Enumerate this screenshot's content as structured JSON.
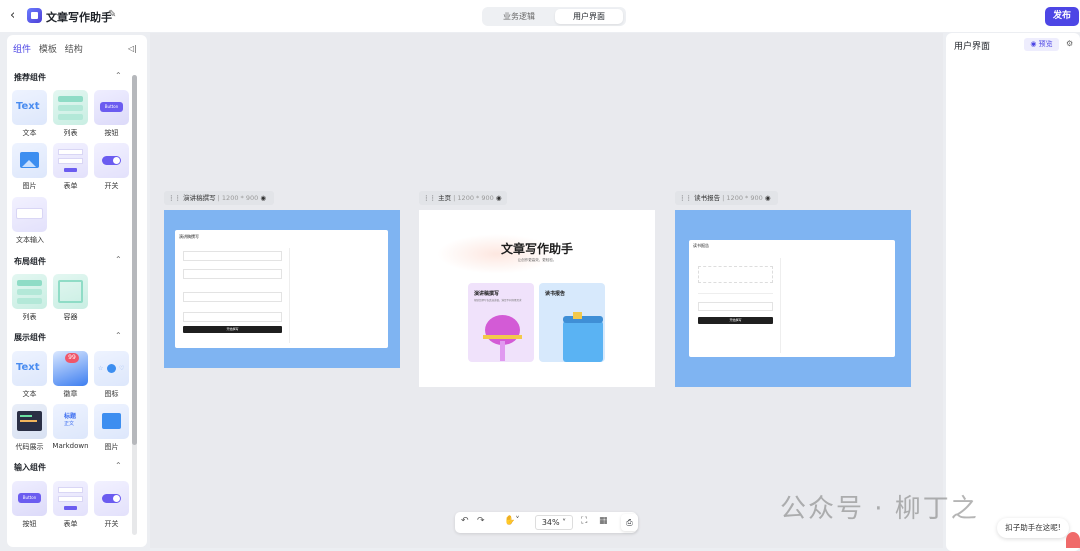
{
  "header": {
    "app_title": "文章写作助手",
    "tabs": [
      {
        "label": "业务逻辑"
      },
      {
        "label": "用户界面"
      }
    ],
    "publish_label": "发布"
  },
  "left_panel": {
    "tabs": [
      "组件",
      "模板",
      "结构"
    ],
    "sections": [
      {
        "title": "推荐组件",
        "items": [
          "文本",
          "列表",
          "按钮",
          "图片",
          "表单",
          "开关",
          "文本输入"
        ]
      },
      {
        "title": "布局组件",
        "items": [
          "列表",
          "容器"
        ]
      },
      {
        "title": "展示组件",
        "items": [
          "文本",
          "徽章",
          "图标",
          "代码展示",
          "Markdown",
          "图片"
        ]
      },
      {
        "title": "输入组件",
        "items": [
          "按钮",
          "表单",
          "开关"
        ]
      }
    ],
    "tile_text": {
      "text": "Text",
      "button": "Button",
      "badge_count": "99",
      "md_title": "标题",
      "md_body": "正文"
    }
  },
  "canvas": {
    "frames": [
      {
        "name": "演讲稿撰写",
        "dims": "1200 * 900",
        "card_title": "演讲稿撰写",
        "submit": "开始撰写"
      },
      {
        "name": "主页",
        "dims": "1200 * 900",
        "hero": "文章写作助手",
        "hero_sub": "让创作更高效，更轻松。",
        "cards": [
          {
            "title": "演讲稿撰写",
            "desc": "帮助您撰写各类演讲稿，满足不同场景需求"
          },
          {
            "title": "读书报告"
          }
        ]
      },
      {
        "name": "读书报告",
        "dims": "1200 * 900",
        "card_title": "读书报告",
        "submit": "开始撰写"
      }
    ],
    "zoom": "34%"
  },
  "right_panel": {
    "title": "用户界面",
    "preview_label": "预览"
  },
  "overlay": {
    "watermark": "公众号 · 柳丁之",
    "assistant": "扣子助手在这呢!"
  }
}
